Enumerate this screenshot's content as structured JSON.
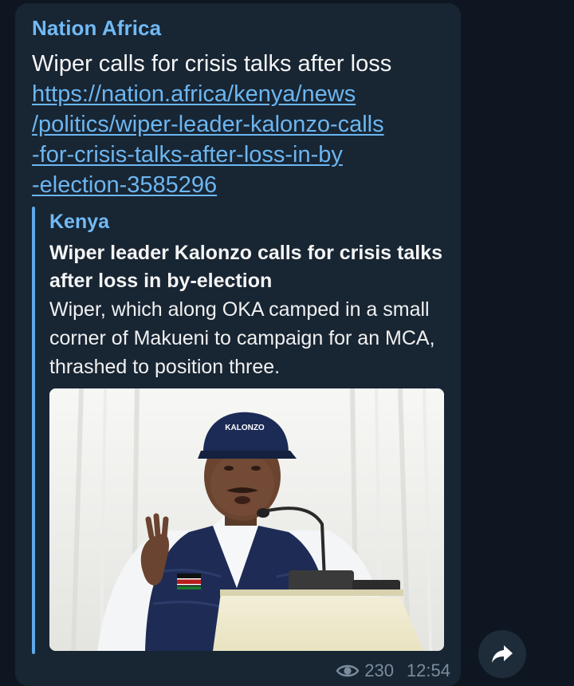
{
  "message": {
    "sender": "Nation Africa",
    "text": "Wiper calls for crisis talks after loss",
    "link_lines": [
      "https://nation.africa/kenya/news",
      "/politics/wiper-leader-kalonzo-calls",
      "-for-crisis-talks-after-loss-in-by",
      "-election-3585296"
    ],
    "views": "230",
    "time": "12:54"
  },
  "preview": {
    "site": "Kenya",
    "title": "Wiper leader Kalonzo calls for crisis talks after loss in by-election",
    "description": "Wiper, which along OKA camped in a small corner of Makueni to campaign for an MCA, thrashed to position three.",
    "image_cap_text": "KALONZO"
  },
  "icons": {
    "views": "eye-icon",
    "share": "share-arrow-icon"
  },
  "colors": {
    "background": "#0e1621",
    "bubble": "#182533",
    "accent": "#71baf5",
    "link": "#6cb6f0",
    "meta": "#7b8c9d"
  }
}
